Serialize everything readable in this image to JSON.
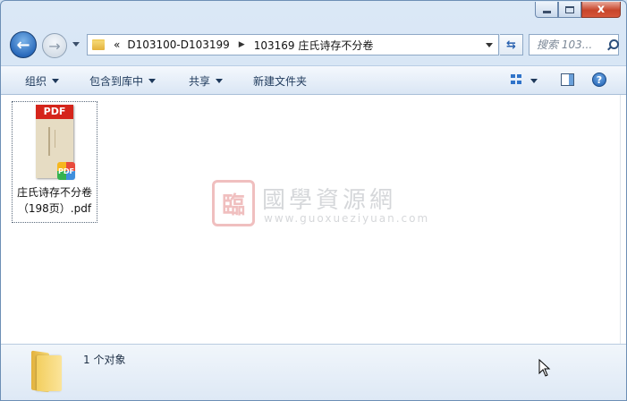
{
  "window": {
    "caption_buttons": {
      "minimize": "minimize",
      "maximize": "maximize",
      "close": "x"
    }
  },
  "nav": {
    "breadcrumb_prefix": "«",
    "breadcrumb": [
      "D103100-D103199",
      "103169 庄氏诗存不分卷"
    ],
    "search_placeholder": "搜索 103..."
  },
  "toolbar": {
    "organize": "组织",
    "include_in_library": "包含到库中",
    "share": "共享",
    "new_folder": "新建文件夹"
  },
  "files": [
    {
      "name_line1": "庄氏诗存不分卷",
      "name_line2": "（198页）.pdf",
      "thumb_header": "PDF",
      "badge": "PDF"
    }
  ],
  "watermark": {
    "title": "國學資源網",
    "url": "www.guoxueziyuan.com"
  },
  "details": {
    "count": "1 个对象"
  },
  "colors": {
    "accent": "#2b6bbc",
    "pdf_red": "#d5251b",
    "close_red": "#c7452b"
  }
}
